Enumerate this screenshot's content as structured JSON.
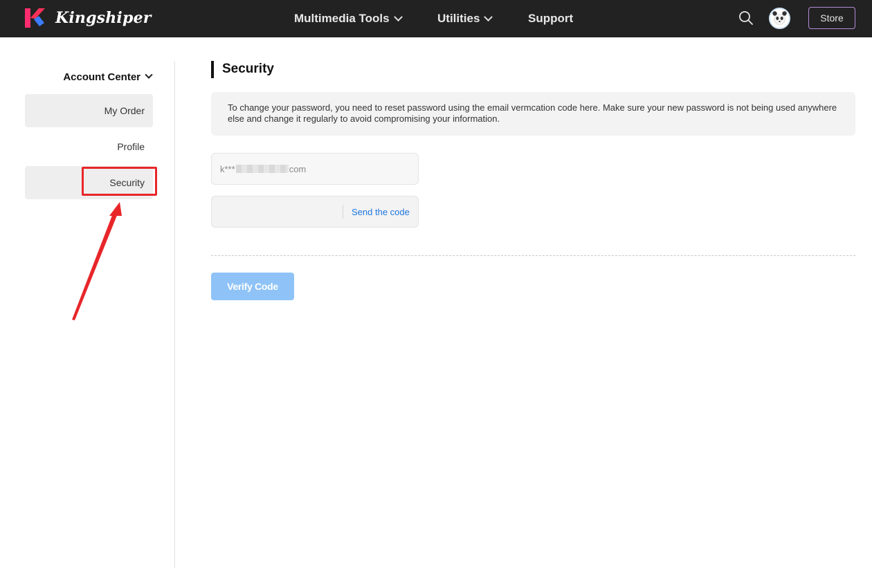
{
  "brand": {
    "name": "Kingshiper"
  },
  "nav": {
    "items": [
      {
        "label": "Multimedia Tools",
        "has_dropdown": true
      },
      {
        "label": "Utilities",
        "has_dropdown": true
      },
      {
        "label": "Support",
        "has_dropdown": false
      }
    ],
    "search_icon": "search-icon",
    "store_label": "Store"
  },
  "sidebar": {
    "section_label": "Account Center",
    "items": [
      {
        "label": "My Order"
      },
      {
        "label": "Profile"
      },
      {
        "label": "Security",
        "active": true
      }
    ]
  },
  "main": {
    "title": "Security",
    "info_text": "To change your password, you need to reset password using the email vermcation code here. Make sure your new password is not being used anywhere else and change it regularly to avoid compromising your information.",
    "email_prefix": "k***",
    "email_suffix": "com",
    "code_placeholder": "",
    "send_code_label": "Send the code",
    "verify_label": "Verify Code"
  },
  "colors": {
    "topbar": "#222222",
    "link_blue": "#1e77e0",
    "verify_button": "#8fc3f7",
    "annotation_red": "#e8262a",
    "store_border": "#b48bd8"
  }
}
